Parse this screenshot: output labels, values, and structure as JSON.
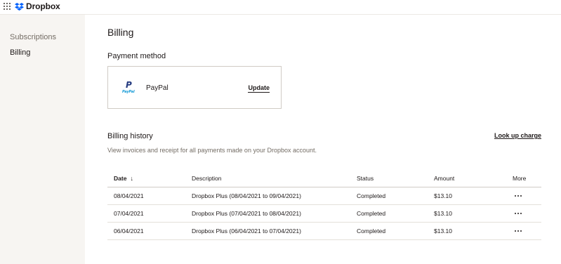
{
  "header": {
    "brand": "Dropbox",
    "apps_icon": "grid-icon",
    "logo_icon": "dropbox-logo-icon"
  },
  "sidebar": {
    "items": [
      {
        "label": "Subscriptions"
      },
      {
        "label": "Billing"
      }
    ]
  },
  "main": {
    "title": "Billing",
    "payment_method": {
      "heading": "Payment method",
      "provider": "PayPal",
      "logo_icon": "paypal-logo-icon",
      "update_label": "Update"
    },
    "billing_history": {
      "heading": "Billing history",
      "lookup_label": "Look up charge",
      "description": "View invoices and receipt for all payments made on your Dropbox account.",
      "columns": {
        "date": "Date",
        "description": "Description",
        "status": "Status",
        "amount": "Amount",
        "more": "More"
      },
      "sort_icon": "arrow-down-icon",
      "rows": [
        {
          "date": "08/04/2021",
          "description": "Dropbox Plus (08/04/2021 to 09/04/2021)",
          "status": "Completed",
          "amount": "$13.10"
        },
        {
          "date": "07/04/2021",
          "description": "Dropbox Plus (07/04/2021 to 08/04/2021)",
          "status": "Completed",
          "amount": "$13.10"
        },
        {
          "date": "06/04/2021",
          "description": "Dropbox Plus (06/04/2021 to 07/04/2021)",
          "status": "Completed",
          "amount": "$13.10"
        }
      ]
    }
  },
  "colors": {
    "sidebar_bg": "#f7f5f2",
    "text": "#1e1919",
    "muted": "#736c64",
    "dropbox_blue": "#0061fe",
    "paypal_dark": "#253b80",
    "paypal_light": "#179bd7"
  }
}
